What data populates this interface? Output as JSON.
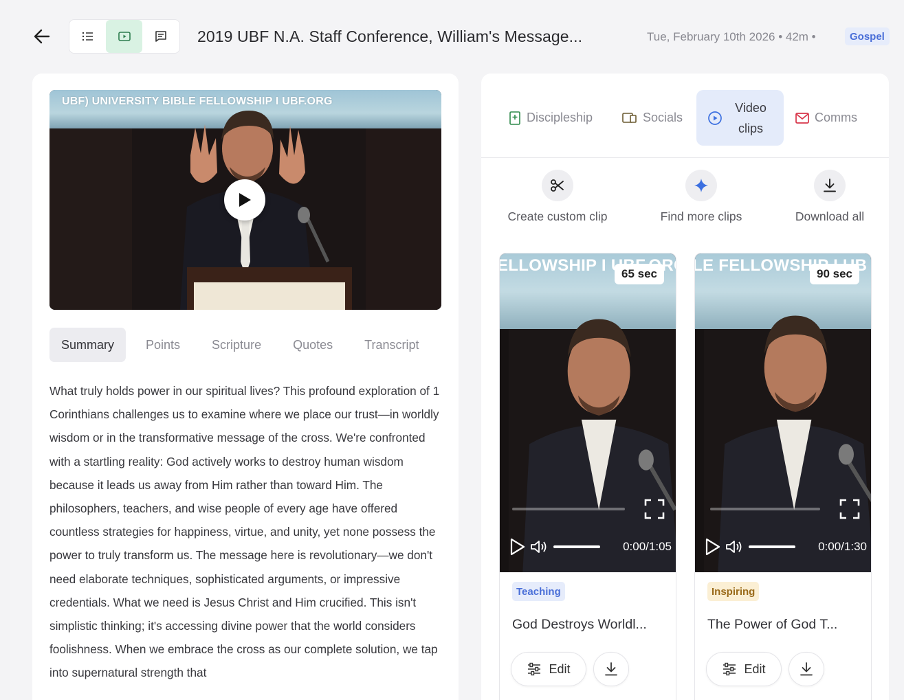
{
  "header": {
    "title": "2019 UBF N.A. Staff Conference, William's Message...",
    "meta": "Tue, February 10th 2026 • 42m •",
    "badge": "Gospel",
    "badge_color": "#4a6fd8",
    "accent_green": "#d9f2e3",
    "view_toggles": [
      "list-icon",
      "video-icon",
      "comment-icon"
    ]
  },
  "main_video": {
    "banner_text": "UBF) UNIVERSITY BIBLE FELLOWSHIP I UBF.ORG",
    "play_icon": "play-icon"
  },
  "tabs": [
    "Summary",
    "Points",
    "Scripture",
    "Quotes",
    "Transcript"
  ],
  "summary_text": "What truly holds power in our spiritual lives? This profound exploration of 1 Corinthians challenges us to examine where we place our trust—in worldly wisdom or in the transformative message of the cross. We're confronted with a startling reality: God actively works to destroy human wisdom because it leads us away from Him rather than toward Him. The philosophers, teachers, and wise people of every age have offered countless strategies for happiness, virtue, and unity, yet none possess the power to truly transform us. The message here is revolutionary—we don't need elaborate techniques, sophisticated arguments, or impressive credentials. What we need is Jesus Christ and Him crucified. This isn't simplistic thinking; it's accessing divine power that the world considers foolishness. When we embrace the cross as our complete solution, we tap into supernatural strength that",
  "right_tabs": [
    {
      "label": "Discipleship",
      "icon": "book-icon"
    },
    {
      "label": "Socials",
      "icon": "socials-icon"
    },
    {
      "label": "Video clips",
      "icon": "play-circle-icon"
    },
    {
      "label": "Comms",
      "icon": "mail-icon"
    }
  ],
  "actions": [
    {
      "label": "Create custom clip",
      "icon": "scissors-icon"
    },
    {
      "label": "Find more clips",
      "icon": "sparkle-icon"
    },
    {
      "label": "Download all",
      "icon": "download-icon"
    }
  ],
  "clips": [
    {
      "banner": "ELLOWSHIP I UBF.ORG",
      "duration": "65 sec",
      "time": "0:00/1:05",
      "tag": "Teaching",
      "tag_color": "#4a6fd8",
      "tag_bg": "#e6ecfb",
      "title": "God Destroys Worldl...",
      "edit_label": "Edit"
    },
    {
      "banner": "LE FELLOWSHIP I UB",
      "duration": "90 sec",
      "time": "0:00/1:30",
      "tag": "Inspiring",
      "tag_color": "#9a6a1a",
      "tag_bg": "#fbefd4",
      "title": "The Power of God T...",
      "edit_label": "Edit"
    }
  ]
}
